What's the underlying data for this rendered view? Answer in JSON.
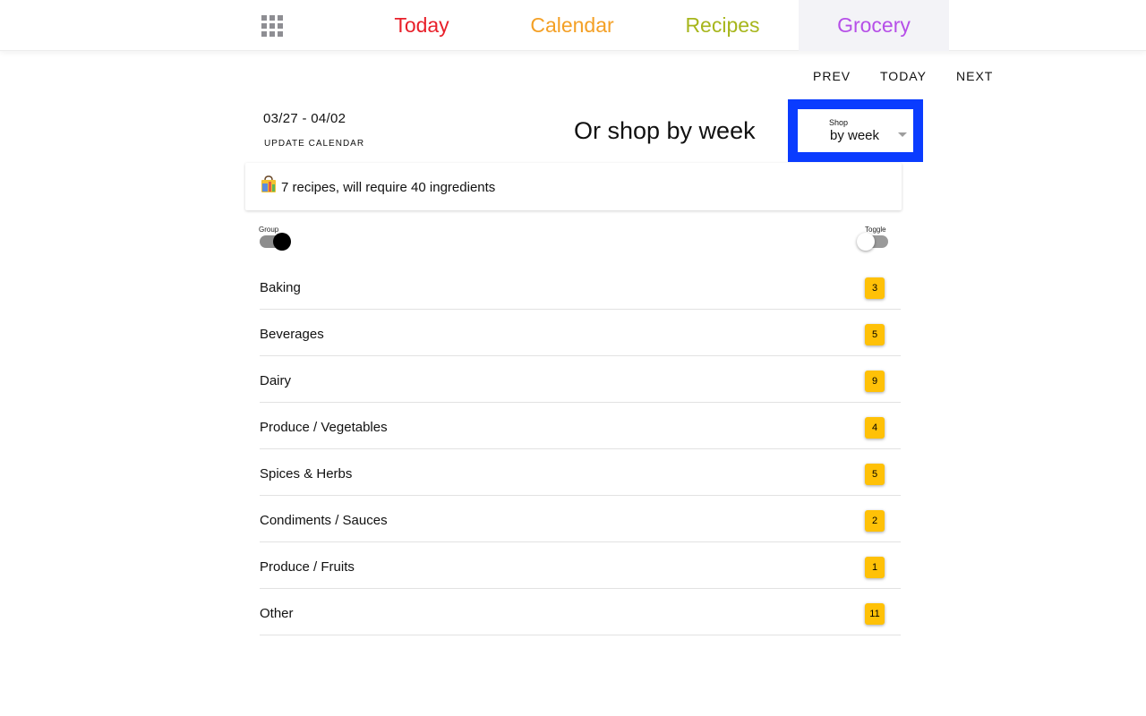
{
  "nav": {
    "tabs": [
      {
        "label": "Today",
        "color": "#e8202a"
      },
      {
        "label": "Calendar",
        "color": "#f4a025"
      },
      {
        "label": "Recipes",
        "color": "#a7b61c"
      },
      {
        "label": "Grocery",
        "color": "#b64fe8",
        "active": true
      }
    ],
    "apps_icon": "grid-icon"
  },
  "week_nav": {
    "prev": "PREV",
    "today": "TODAY",
    "next": "NEXT"
  },
  "range": {
    "dates": "03/27 - 04/02",
    "update": "UPDATE CALENDAR"
  },
  "shop": {
    "caption": "Or shop by week",
    "label": "Shop",
    "value": "by week",
    "highlight_color": "#0a3cff"
  },
  "summary": {
    "icon": "shopping-bag-icon",
    "text": "7 recipes, will require 40 ingredients"
  },
  "toggles": {
    "group": {
      "label": "Group",
      "on": true
    },
    "toggle": {
      "label": "Toggle",
      "on": false
    }
  },
  "categories": [
    {
      "name": "Baking",
      "count": "3"
    },
    {
      "name": "Beverages",
      "count": "5"
    },
    {
      "name": "Dairy",
      "count": "9"
    },
    {
      "name": "Produce / Vegetables",
      "count": "4"
    },
    {
      "name": "Spices & Herbs",
      "count": "5"
    },
    {
      "name": "Condiments / Sauces",
      "count": "2"
    },
    {
      "name": "Produce / Fruits",
      "count": "1"
    },
    {
      "name": "Other",
      "count": "11"
    }
  ],
  "badge_color": "#ffc107"
}
